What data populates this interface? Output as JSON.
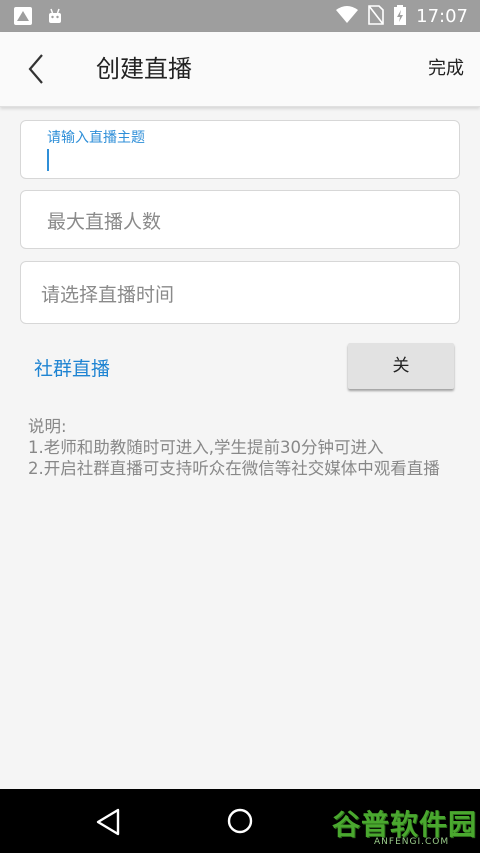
{
  "status_bar": {
    "time": "17:07",
    "icons": [
      "app-icon",
      "android-robot-icon",
      "wifi-icon",
      "no-sim-icon",
      "battery-charging-icon"
    ]
  },
  "app_bar": {
    "title": "创建直播",
    "done_label": "完成",
    "back_icon": "chevron-left-icon"
  },
  "form": {
    "topic": {
      "label": "请输入直播主题",
      "value": ""
    },
    "max_viewers": {
      "placeholder": "最大直播人数",
      "value": ""
    },
    "time": {
      "placeholder": "请选择直播时间",
      "value": ""
    }
  },
  "community_live": {
    "label": "社群直播",
    "toggle_label": "关"
  },
  "notes": {
    "heading": "说明:",
    "line1": "1.老师和助教随时可进入,学生提前30分钟可进入",
    "line2": "2.开启社群直播可支持听众在微信等社交媒体中观看直播"
  },
  "watermark": {
    "text": "谷普软件园",
    "sub": "ANFENGI.COM"
  },
  "colors": {
    "accent": "#1f84d2",
    "status_bar": "#9e9e9e",
    "nav_bar": "#000000"
  }
}
